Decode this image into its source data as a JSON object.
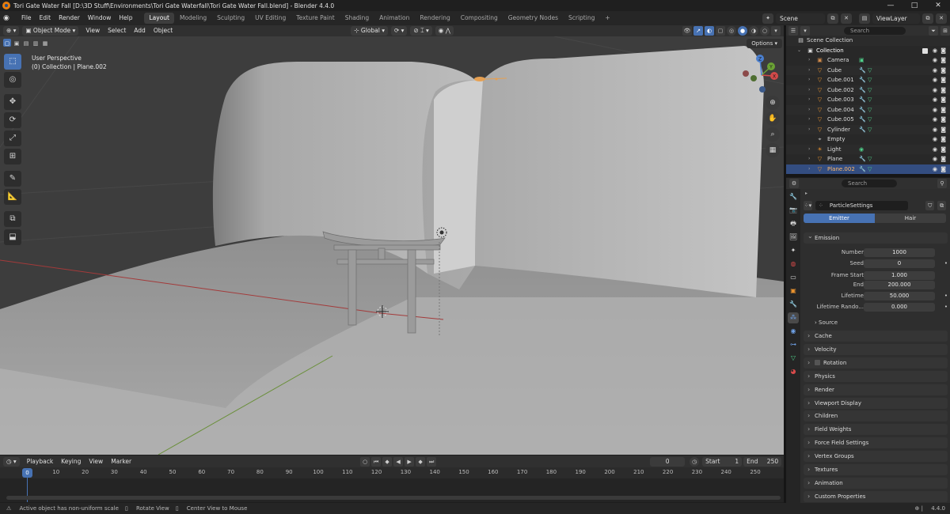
{
  "window": {
    "title": "Tori Gate Water Fall [D:\\3D Stuff\\Environments\\Tori Gate Waterfall\\Tori Gate Water Fall.blend] - Blender 4.4.0",
    "controls": [
      "—",
      "□",
      "✕"
    ]
  },
  "menus": [
    "File",
    "Edit",
    "Render",
    "Window",
    "Help"
  ],
  "workspaces": [
    {
      "label": "Layout",
      "active": true
    },
    {
      "label": "Modeling"
    },
    {
      "label": "Sculpting"
    },
    {
      "label": "UV Editing"
    },
    {
      "label": "Texture Paint"
    },
    {
      "label": "Shading"
    },
    {
      "label": "Animation"
    },
    {
      "label": "Rendering"
    },
    {
      "label": "Compositing"
    },
    {
      "label": "Geometry Nodes"
    },
    {
      "label": "Scripting"
    },
    {
      "label": "+"
    }
  ],
  "scene": {
    "name": "Scene",
    "view_layer": "ViewLayer"
  },
  "viewport": {
    "mode": "Object Mode",
    "menus": [
      "View",
      "Select",
      "Add",
      "Object"
    ],
    "orientation": "Global",
    "options_label": "Options",
    "info_line1": "User Perspective",
    "info_line2": "(0) Collection | Plane.002",
    "gizmo": {
      "x": "X",
      "y": "Y",
      "z": "Z"
    },
    "tools": [
      "select-box",
      "cursor",
      "move",
      "rotate",
      "scale",
      "transform",
      "annotate",
      "measure",
      "add-cube",
      "extrude"
    ]
  },
  "outliner": {
    "search_placeholder": "Search",
    "root": "Scene Collection",
    "collection": "Collection",
    "items": [
      {
        "name": "Camera",
        "icon": "camera-icon",
        "color": "#d08a4a"
      },
      {
        "name": "Cube",
        "icon": "mesh-icon",
        "color": "#e8922e"
      },
      {
        "name": "Cube.001",
        "icon": "mesh-icon",
        "color": "#e8922e"
      },
      {
        "name": "Cube.002",
        "icon": "mesh-icon",
        "color": "#e8922e"
      },
      {
        "name": "Cube.003",
        "icon": "mesh-icon",
        "color": "#e8922e"
      },
      {
        "name": "Cube.004",
        "icon": "mesh-icon",
        "color": "#e8922e"
      },
      {
        "name": "Cube.005",
        "icon": "mesh-icon",
        "color": "#e8922e"
      },
      {
        "name": "Cylinder",
        "icon": "mesh-icon",
        "color": "#e8922e"
      },
      {
        "name": "Empty",
        "icon": "empty-icon",
        "color": "#c8c8c8"
      },
      {
        "name": "Light",
        "icon": "light-icon",
        "color": "#e8922e"
      },
      {
        "name": "Plane",
        "icon": "mesh-icon",
        "color": "#e8922e"
      },
      {
        "name": "Plane.002",
        "icon": "mesh-icon",
        "color": "#e8922e",
        "selected": true
      }
    ]
  },
  "properties": {
    "search_placeholder": "Search",
    "particle_settings_name": "ParticleSettings",
    "type_tabs": [
      "Emitter",
      "Hair"
    ],
    "emission": {
      "header": "Emission",
      "rows": [
        {
          "label": "Number",
          "value": "1000"
        },
        {
          "label": "Seed",
          "value": "0"
        },
        {
          "label": "Frame Start",
          "value": "1.000"
        },
        {
          "label": "End",
          "value": "200.000"
        },
        {
          "label": "Lifetime",
          "value": "50.000"
        },
        {
          "label": "Lifetime Rando...",
          "value": "0.000"
        }
      ],
      "source": "Source"
    },
    "panels": [
      "Cache",
      "Velocity",
      "Rotation",
      "Physics",
      "Render",
      "Viewport Display",
      "Children",
      "Field Weights",
      "Force Field Settings",
      "Vertex Groups",
      "Textures",
      "Animation",
      "Custom Properties"
    ]
  },
  "timeline": {
    "menus": [
      "Playback",
      "Keying",
      "View",
      "Marker"
    ],
    "current_frame": "0",
    "start_label": "Start",
    "start": "1",
    "end_label": "End",
    "end": "250",
    "ticks": [
      "0",
      "10",
      "20",
      "30",
      "40",
      "50",
      "60",
      "70",
      "80",
      "90",
      "100",
      "110",
      "120",
      "130",
      "140",
      "150",
      "160",
      "170",
      "180",
      "190",
      "200",
      "210",
      "220",
      "230",
      "240",
      "250"
    ]
  },
  "statusbar": {
    "items": [
      "Active object has non-uniform scale",
      "Rotate View",
      "Center View to Mouse"
    ],
    "version": "4.4.0"
  },
  "colors": {
    "accent": "#4772b3",
    "selected_row": "#334d80",
    "mesh_orange": "#e8922e",
    "modifier_blue": "#6fa2e8"
  }
}
